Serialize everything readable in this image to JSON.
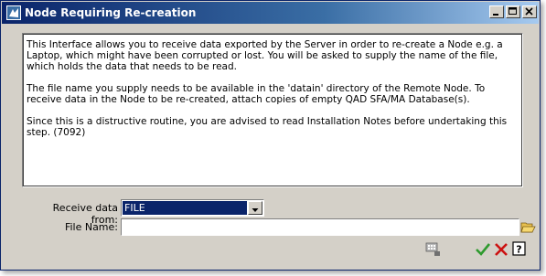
{
  "window": {
    "title": "Node Requiring Re-creation",
    "controls": [
      "minimize-icon",
      "maximize-icon",
      "close-icon"
    ]
  },
  "description": {
    "paragraphs": [
      "This Interface allows you to receive data exported by the Server in order to re-create a Node e.g. a Laptop, which might have been corrupted or lost. You will be asked to supply the name of the file, which holds the data that needs to be read.",
      "The file name you supply needs to be available in the 'datain' directory of the Remote Node. To receive data in the Node to be re-created, attach copies of empty QAD SFA/MA Database(s).",
      "Since this is a distructive routine, you are advised to read Installation Notes before undertaking this step. (7092)"
    ]
  },
  "form": {
    "receive_label": "Receive data from:",
    "receive_value": "FILE",
    "filename_label": "File Name:",
    "filename_value": ""
  },
  "toolbar": {
    "icons": [
      "keyboard-icon",
      "ok-check-icon",
      "cancel-x-icon",
      "help-icon",
      "open-folder-icon"
    ]
  },
  "colors": {
    "title_bar_start": "#0a246a",
    "title_bar_end": "#a6caf0",
    "dialog_bg": "#d4d0c8",
    "selection": "#0a246a",
    "ok_green": "#2e9a2e",
    "cancel_red": "#cc1111"
  }
}
